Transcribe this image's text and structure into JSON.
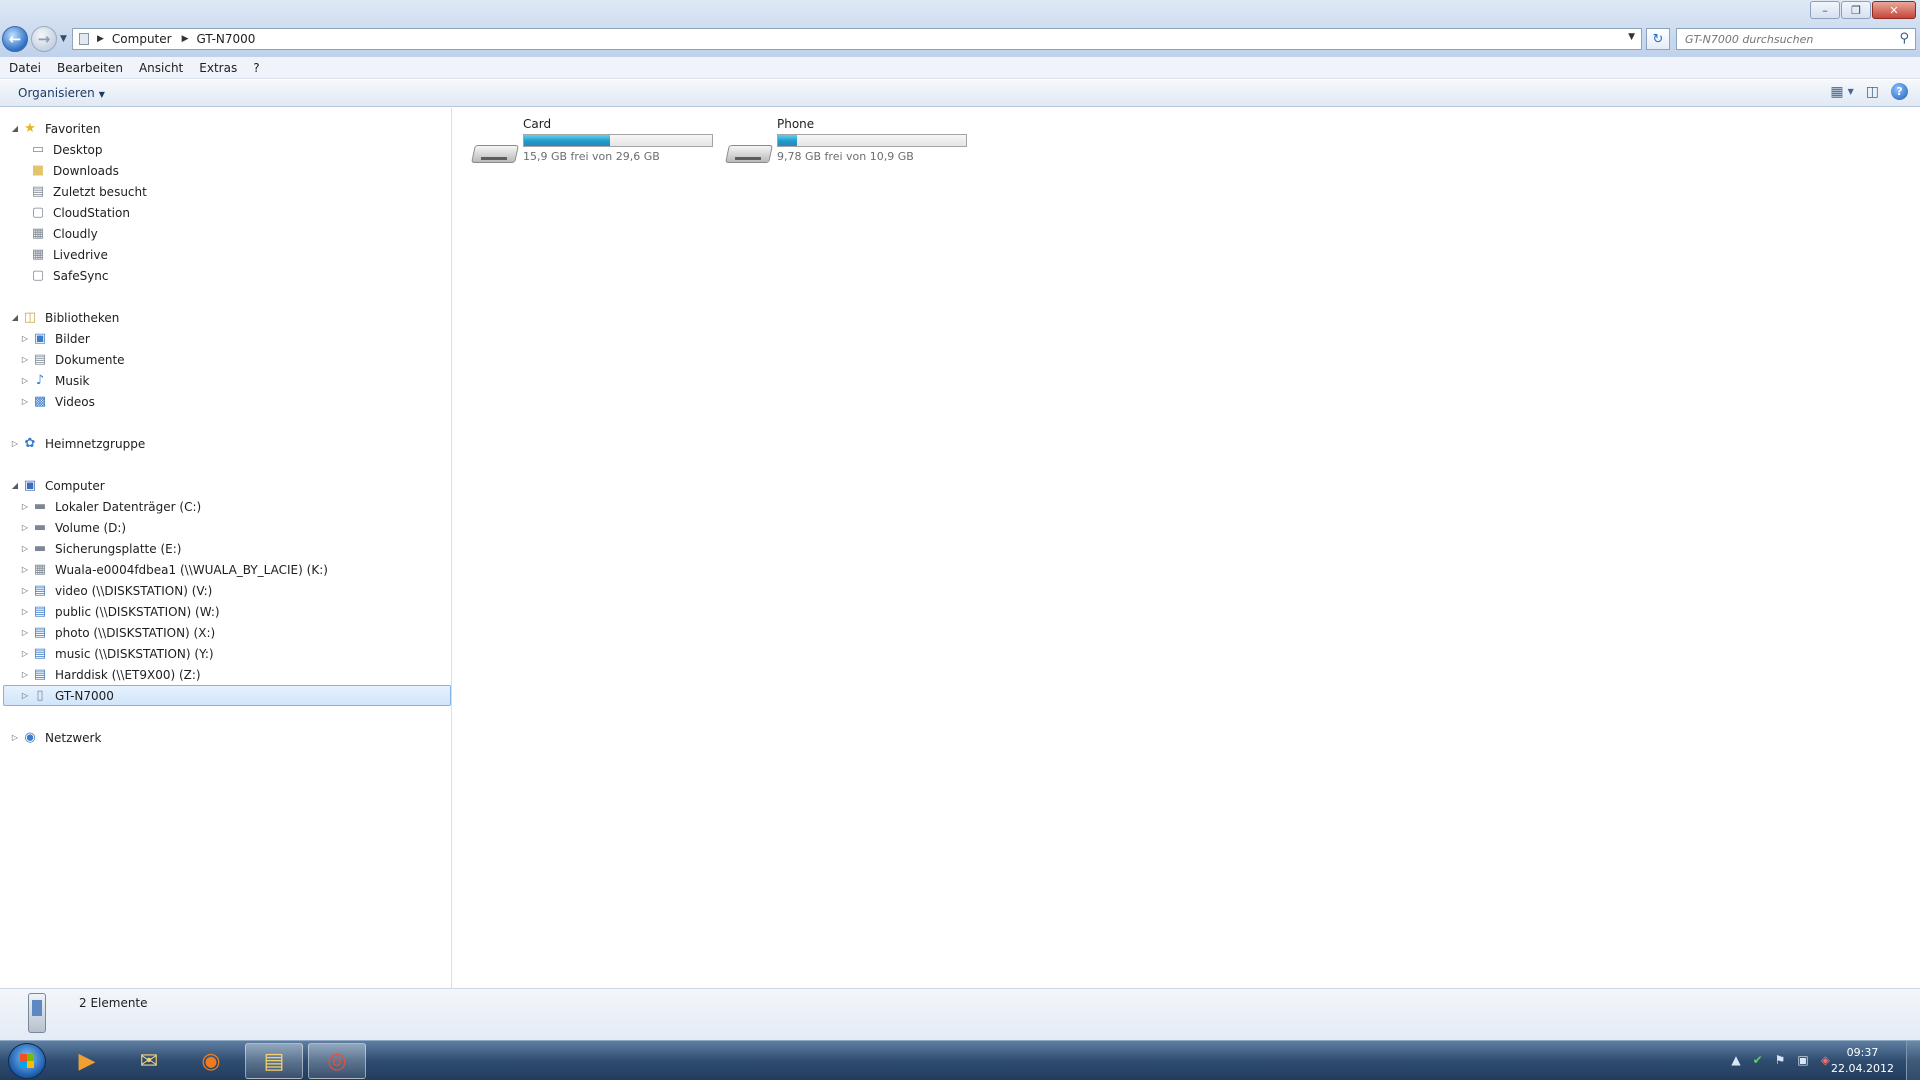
{
  "address": {
    "crumbs": [
      "Computer",
      "GT-N7000"
    ],
    "search_placeholder": "GT-N7000 durchsuchen"
  },
  "menubar": [
    "Datei",
    "Bearbeiten",
    "Ansicht",
    "Extras",
    "?"
  ],
  "toolbar": {
    "organize": "Organisieren"
  },
  "nav": {
    "favorites": {
      "label": "Favoriten",
      "items": [
        "Desktop",
        "Downloads",
        "Zuletzt besucht",
        "CloudStation",
        "Cloudly",
        "Livedrive",
        "SafeSync"
      ]
    },
    "libraries": {
      "label": "Bibliotheken",
      "items": [
        "Bilder",
        "Dokumente",
        "Musik",
        "Videos"
      ]
    },
    "homegroup": "Heimnetzgruppe",
    "computer": {
      "label": "Computer",
      "items": [
        "Lokaler Datenträger (C:)",
        "Volume (D:)",
        "Sicherungsplatte (E:)",
        "Wuala-e0004fdbea1 (\\\\WUALA_BY_LACIE) (K:)",
        "video (\\\\DISKSTATION) (V:)",
        "public (\\\\DISKSTATION) (W:)",
        "photo (\\\\DISKSTATION) (X:)",
        "music (\\\\DISKSTATION) (Y:)",
        "Harddisk (\\\\ET9X00) (Z:)",
        "GT-N7000"
      ],
      "selected": "GT-N7000"
    },
    "network": "Netzwerk"
  },
  "drives": [
    {
      "name": "Card",
      "free": "15,9 GB frei von 29,6 GB",
      "used_fraction": 0.46
    },
    {
      "name": "Phone",
      "free": "9,78 GB frei von 10,9 GB",
      "used_fraction": 0.1
    }
  ],
  "status": {
    "items_count": "2 Elemente"
  },
  "clock": {
    "time": "09:37",
    "date": "22.04.2012"
  },
  "colors": {
    "accent": "#2e70c7",
    "selection": "#d0e5fb",
    "bar_fill": "#1f9ac9"
  }
}
